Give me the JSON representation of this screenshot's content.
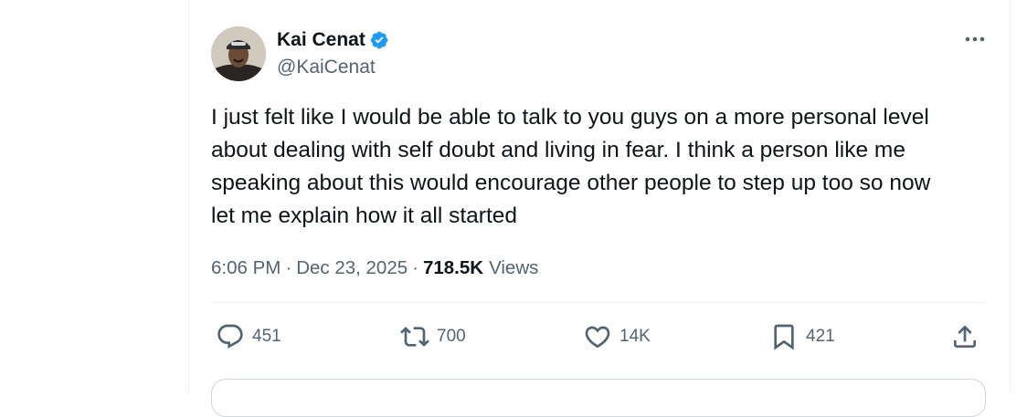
{
  "tweet": {
    "author": {
      "display_name": "Kai Cenat",
      "handle": "@KaiCenat",
      "verified": true
    },
    "text": "I just felt like I would be able to talk to you guys on a more personal level\nabout dealing with self doubt and living in fear. I think a person like me\nspeaking about this would encourage other people to step up too so now\nlet me explain how it all started",
    "time": "6:06 PM",
    "separator": "·",
    "date": "Dec 23, 2025",
    "views_count": "718.5K",
    "views_label": "Views",
    "actions": {
      "replies": "451",
      "reposts": "700",
      "likes": "14K",
      "bookmarks": "421"
    }
  },
  "icons": {
    "more": "more-horizontal-icon",
    "reply": "reply-icon",
    "retweet": "retweet-icon",
    "like": "heart-icon",
    "bookmark": "bookmark-icon",
    "share": "share-icon",
    "verified": "verified-badge-icon"
  },
  "colors": {
    "text_primary": "#0f1419",
    "text_secondary": "#536471",
    "verified_blue": "#1d9bf0",
    "border": "#eff3f4"
  }
}
